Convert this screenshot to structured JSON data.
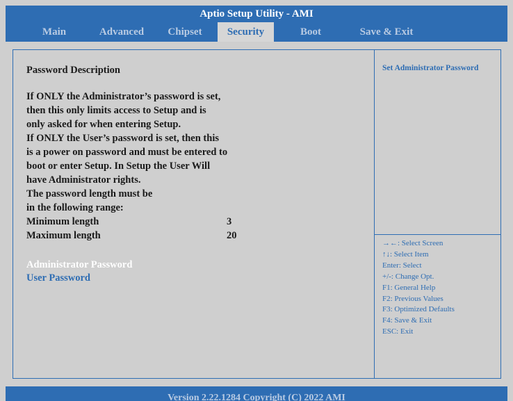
{
  "app": {
    "title": "Aptio Setup Utility - AMI"
  },
  "tabs": [
    {
      "label": "Main"
    },
    {
      "label": "Advanced"
    },
    {
      "label": "Chipset"
    },
    {
      "label": "Security",
      "active": true
    },
    {
      "label": "Boot"
    },
    {
      "label": "Save & Exit"
    }
  ],
  "description": {
    "heading": "Password Description",
    "lines": [
      "If ONLY the Administrator’s password is set,",
      "then this only limits access to Setup and is",
      "only asked for when entering Setup.",
      "If ONLY the User’s password is set, then this",
      "is a power on password and must be entered to",
      "boot or enter Setup. In Setup the User Will",
      "have Administrator rights.",
      "The password length must be",
      "in the following range:"
    ],
    "min_label": "Minimum length",
    "min_value": "3",
    "max_label": "Maximum length",
    "max_value": "20"
  },
  "menu": {
    "admin_password": "Administrator Password",
    "user_password": "User Password"
  },
  "help": {
    "title": "Set Administrator Password",
    "keys": [
      "→←: Select Screen",
      "↑↓: Select Item",
      "Enter: Select",
      "+/-: Change Opt.",
      "F1: General Help",
      "F2: Previous Values",
      "F3: Optimized Defaults",
      "F4: Save & Exit",
      "ESC: Exit"
    ]
  },
  "footer": {
    "version": "Version 2.22.1284 Copyright (C) 2022 AMI"
  },
  "colors": {
    "bar": "#2e6db3",
    "background": "#cfcfcf",
    "highlight": "#ffffff",
    "text": "#1a1a1a"
  }
}
